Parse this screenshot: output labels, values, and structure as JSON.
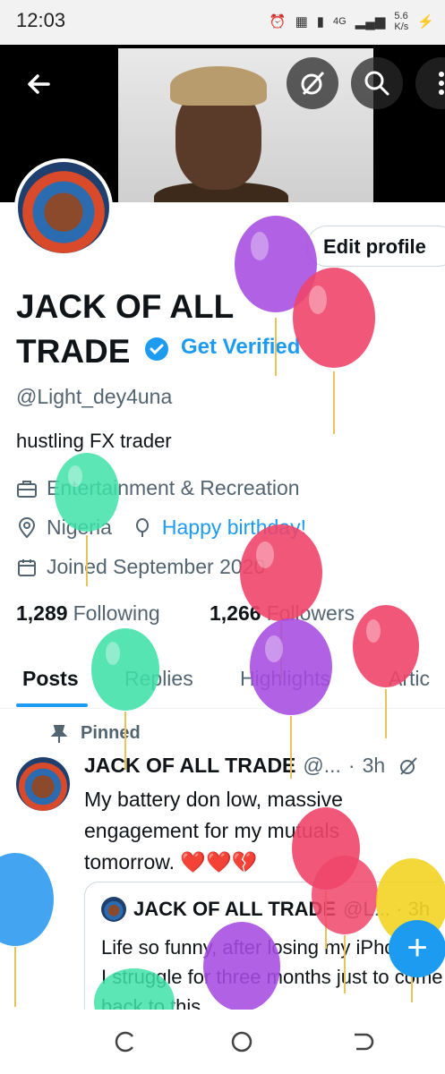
{
  "status": {
    "time": "12:03",
    "network_label": "4G",
    "speed_value": "5.6",
    "speed_unit": "K/s"
  },
  "profile": {
    "name_line1": "JACK OF ALL",
    "name_line2": "TRADE",
    "get_verified": "Get Verified",
    "handle": "@Light_dey4una",
    "bio": "hustling FX trader",
    "category": "Entertainment & Recreation",
    "location": "Nigeria",
    "birthday_link": "Happy birthday!",
    "joined": "Joined September 2020",
    "following_count": "1,289",
    "following_label": "Following",
    "followers_count": "1,266",
    "followers_label": "Followers",
    "edit_profile": "Edit profile"
  },
  "tabs": [
    "Posts",
    "Replies",
    "Highlights",
    "Artic"
  ],
  "post": {
    "pinned_label": "Pinned",
    "author": "JACK OF ALL TRADE",
    "handle_trunc": "@...",
    "dot": "·",
    "time": "3h",
    "text": "My battery don low, massive engagement for my mutuals tomorrow. ❤️❤️💔",
    "quote": {
      "author": "JACK OF ALL TRADE",
      "handle_trunc": "@L... · 3h",
      "text": "Life so funny, after losing my iPhone 11, I struggle for three months just to come back to this"
    }
  },
  "fab_label": "+",
  "colors": {
    "accent": "#1d9bf0",
    "balloon_purple": "#a64be0",
    "balloon_pink": "#f0456a",
    "balloon_green": "#3fe0a8",
    "balloon_blue": "#2f9bf0",
    "balloon_yellow": "#f3d21c"
  }
}
